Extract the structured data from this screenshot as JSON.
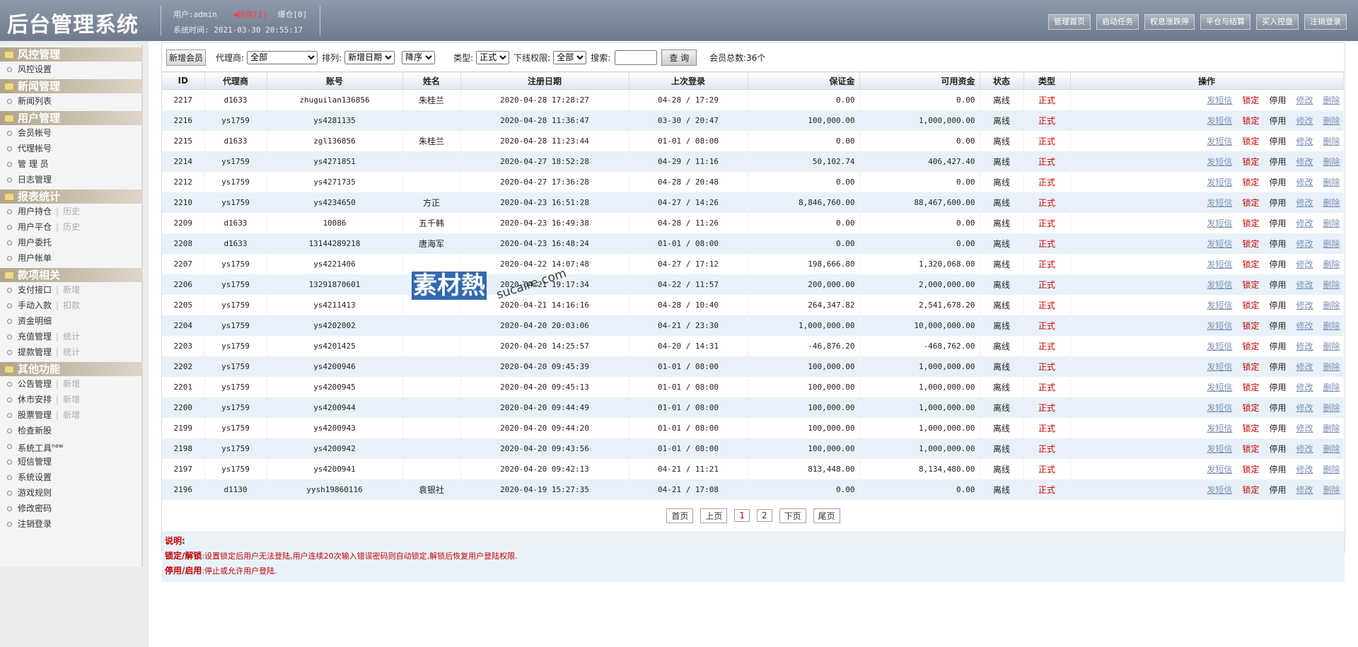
{
  "header": {
    "title": "后台管理系统",
    "user_label": "用户:admin",
    "sms_label": "短信[1]",
    "warehouse_label": "爆仓[0]",
    "system_time": "系统时间: 2021-03-30 20:55:17",
    "buttons": [
      "管理首页",
      "启动任务",
      "权息涨跌停",
      "平仓与结算",
      "买入控盘",
      "注销登录"
    ]
  },
  "sidebar": {
    "sec_risk": "风控管理",
    "risk_settings": "风控设置",
    "sec_news": "新闻管理",
    "news_list": "新闻列表",
    "sec_user": "用户管理",
    "member_account": "会员帐号",
    "agent_account": "代理帐号",
    "admin": "管 理 员",
    "log_mgmt": "日志管理",
    "sec_report": "报表统计",
    "user_position": "用户持仓",
    "history": "历史",
    "user_close": "用户平仓",
    "user_order": "用户委托",
    "user_bill": "用户帐单",
    "sec_funds": "款项相关",
    "payment_api": "支付接口",
    "add": "新增",
    "manual_in": "手动入款",
    "deduct": "扣款",
    "fund_detail": "资金明细",
    "recharge_mgmt": "充值管理",
    "stats": "统计",
    "withdraw_mgmt": "提款管理",
    "sec_other": "其他功能",
    "notice_mgmt": "公告管理",
    "holiday": "休市安排",
    "stock_mgmt": "股票管理",
    "check_new": "检查新股",
    "sys_tools": "系统工具",
    "new_badge": "new",
    "sms_mgmt": "短信管理",
    "sys_settings": "系统设置",
    "game_rules": "游戏规则",
    "change_pwd": "修改密码",
    "logout": "注销登录"
  },
  "toolbar": {
    "add_member": "新增会员",
    "agent_label": "代理商:",
    "agent_value": "全部",
    "sort_label": "排列:",
    "sort_value": "新增日期",
    "order_value": "降序",
    "type_label": "类型:",
    "type_value": "正式",
    "down_label": "下线权限:",
    "down_value": "全部",
    "search_label": "搜索:",
    "search_value": "",
    "query_btn": "查 询",
    "total": "会员总数:36个"
  },
  "table": {
    "columns": [
      "ID",
      "代理商",
      "账号",
      "姓名",
      "注册日期",
      "上次登录",
      "保证金",
      "可用资金",
      "状态",
      "类型",
      "操作"
    ],
    "ops": [
      "发短信",
      "锁定",
      "停用",
      "修改",
      "删除"
    ],
    "rows": [
      [
        "2217",
        "d1633",
        "zhuguilan136856",
        "朱桂兰",
        "2020-04-28 17:28:27",
        "04-28 / 17:29",
        "0.00",
        "0.00",
        "离线",
        "正式"
      ],
      [
        "2216",
        "ys1759",
        "ys4281135",
        "",
        "2020-04-28 11:36:47",
        "03-30 / 20:47",
        "100,000.00",
        "1,000,000.00",
        "离线",
        "正式"
      ],
      [
        "2215",
        "d1633",
        "zgl136856",
        "朱桂兰",
        "2020-04-28 11:23:44",
        "01-01 / 08:00",
        "0.00",
        "0.00",
        "离线",
        "正式"
      ],
      [
        "2214",
        "ys1759",
        "ys4271851",
        "",
        "2020-04-27 18:52:28",
        "04-29 / 11:16",
        "50,102.74",
        "406,427.40",
        "离线",
        "正式"
      ],
      [
        "2212",
        "ys1759",
        "ys4271735",
        "",
        "2020-04-27 17:36:28",
        "04-28 / 20:48",
        "0.00",
        "0.00",
        "离线",
        "正式"
      ],
      [
        "2210",
        "ys1759",
        "ys4234650",
        "方正",
        "2020-04-23 16:51:28",
        "04-27 / 14:26",
        "8,846,760.00",
        "88,467,600.00",
        "离线",
        "正式"
      ],
      [
        "2209",
        "d1633",
        "10086",
        "五千韩",
        "2020-04-23 16:49:38",
        "04-28 / 11:26",
        "0.00",
        "0.00",
        "离线",
        "正式"
      ],
      [
        "2208",
        "d1633",
        "13144289218",
        "唐海军",
        "2020-04-23 16:48:24",
        "01-01 / 08:00",
        "0.00",
        "0.00",
        "离线",
        "正式"
      ],
      [
        "2207",
        "ys1759",
        "ys4221406",
        "",
        "2020-04-22 14:07:48",
        "04-27 / 17:12",
        "198,666.80",
        "1,320,068.00",
        "离线",
        "正式"
      ],
      [
        "2206",
        "ys1759",
        "13291870601",
        "",
        "2020-04-21 19:17:34",
        "04-22 / 11:57",
        "200,000.00",
        "2,000,000.00",
        "离线",
        "正式"
      ],
      [
        "2205",
        "ys1759",
        "ys4211413",
        "",
        "2020-04-21 14:16:16",
        "04-28 / 10:40",
        "264,347.82",
        "2,541,678.20",
        "离线",
        "正式"
      ],
      [
        "2204",
        "ys1759",
        "ys4202002",
        "",
        "2020-04-20 20:03:06",
        "04-21 / 23:30",
        "1,000,000.00",
        "10,000,000.00",
        "离线",
        "正式"
      ],
      [
        "2203",
        "ys1759",
        "ys4201425",
        "",
        "2020-04-20 14:25:57",
        "04-20 / 14:31",
        "-46,876.20",
        "-468,762.00",
        "离线",
        "正式"
      ],
      [
        "2202",
        "ys1759",
        "ys4200946",
        "",
        "2020-04-20 09:45:39",
        "01-01 / 08:00",
        "100,000.00",
        "1,000,000.00",
        "离线",
        "正式"
      ],
      [
        "2201",
        "ys1759",
        "ys4200945",
        "",
        "2020-04-20 09:45:13",
        "01-01 / 08:00",
        "100,000.00",
        "1,000,000.00",
        "离线",
        "正式"
      ],
      [
        "2200",
        "ys1759",
        "ys4200944",
        "",
        "2020-04-20 09:44:49",
        "01-01 / 08:00",
        "100,000.00",
        "1,000,000.00",
        "离线",
        "正式"
      ],
      [
        "2199",
        "ys1759",
        "ys4200943",
        "",
        "2020-04-20 09:44:20",
        "01-01 / 08:00",
        "100,000.00",
        "1,000,000.00",
        "离线",
        "正式"
      ],
      [
        "2198",
        "ys1759",
        "ys4200942",
        "",
        "2020-04-20 09:43:56",
        "01-01 / 08:00",
        "100,000.00",
        "1,000,000.00",
        "离线",
        "正式"
      ],
      [
        "2197",
        "ys1759",
        "ys4200941",
        "",
        "2020-04-20 09:42:13",
        "04-21 / 11:21",
        "813,448.00",
        "8,134,480.00",
        "离线",
        "正式"
      ],
      [
        "2196",
        "d1130",
        "yysh19860116",
        "袁银社",
        "2020-04-19 15:27:35",
        "04-21 / 17:08",
        "0.00",
        "0.00",
        "离线",
        "正式"
      ]
    ]
  },
  "pager": {
    "first": "首页",
    "prev": "上页",
    "p1": "1",
    "p2": "2",
    "next": "下页",
    "last": "尾页"
  },
  "notes": {
    "title": "说明:",
    "lock_label": "锁定/解锁",
    "lock_text": ":设置锁定后用户无法登陆,用户连续20次输入错误密码则自动锁定,解锁后恢复用户登陆权限.",
    "disable_label": "停用/启用",
    "disable_text": ":停止或允许用户登陆."
  },
  "watermark": {
    "brand": "素材熱",
    "url": "sucaire.com"
  }
}
